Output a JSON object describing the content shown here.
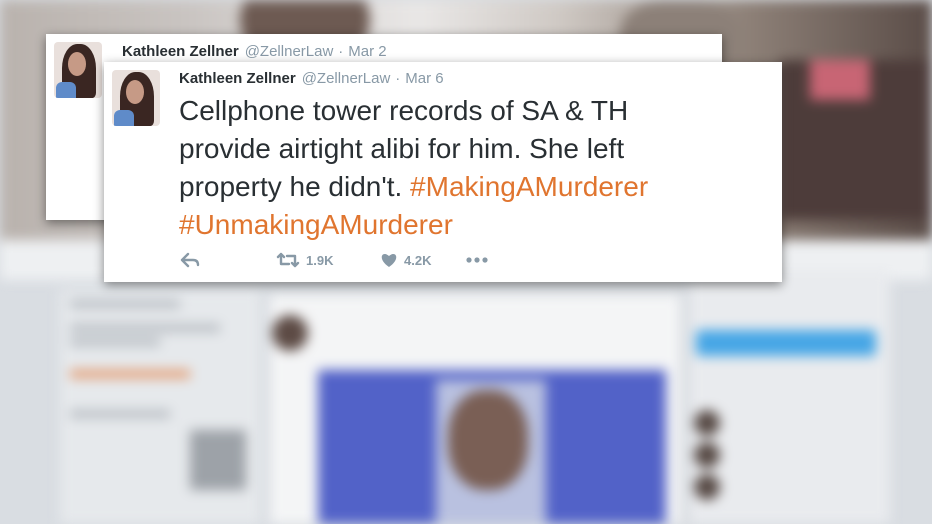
{
  "tweet_back": {
    "name": "Kathleen Zellner",
    "handle": "@ZellnerLaw",
    "separator": "·",
    "date": "Mar 2"
  },
  "tweet_front": {
    "name": "Kathleen Zellner",
    "handle": "@ZellnerLaw",
    "separator": "·",
    "date": "Mar 6",
    "text_line1": "Cellphone tower records of SA & TH",
    "text_line2": "provide airtight alibi for him. She left",
    "text_line3_plain": "property he didn't. ",
    "hashtag1": "#MakingAMurderer",
    "hashtag2": "#UnmakingAMurderer",
    "retweets": "1.9K",
    "likes": "4.2K",
    "icons": [
      "reply-icon",
      "retweet-icon",
      "heart-icon",
      "more-icon"
    ],
    "hashtag_color": "#e0752f"
  }
}
